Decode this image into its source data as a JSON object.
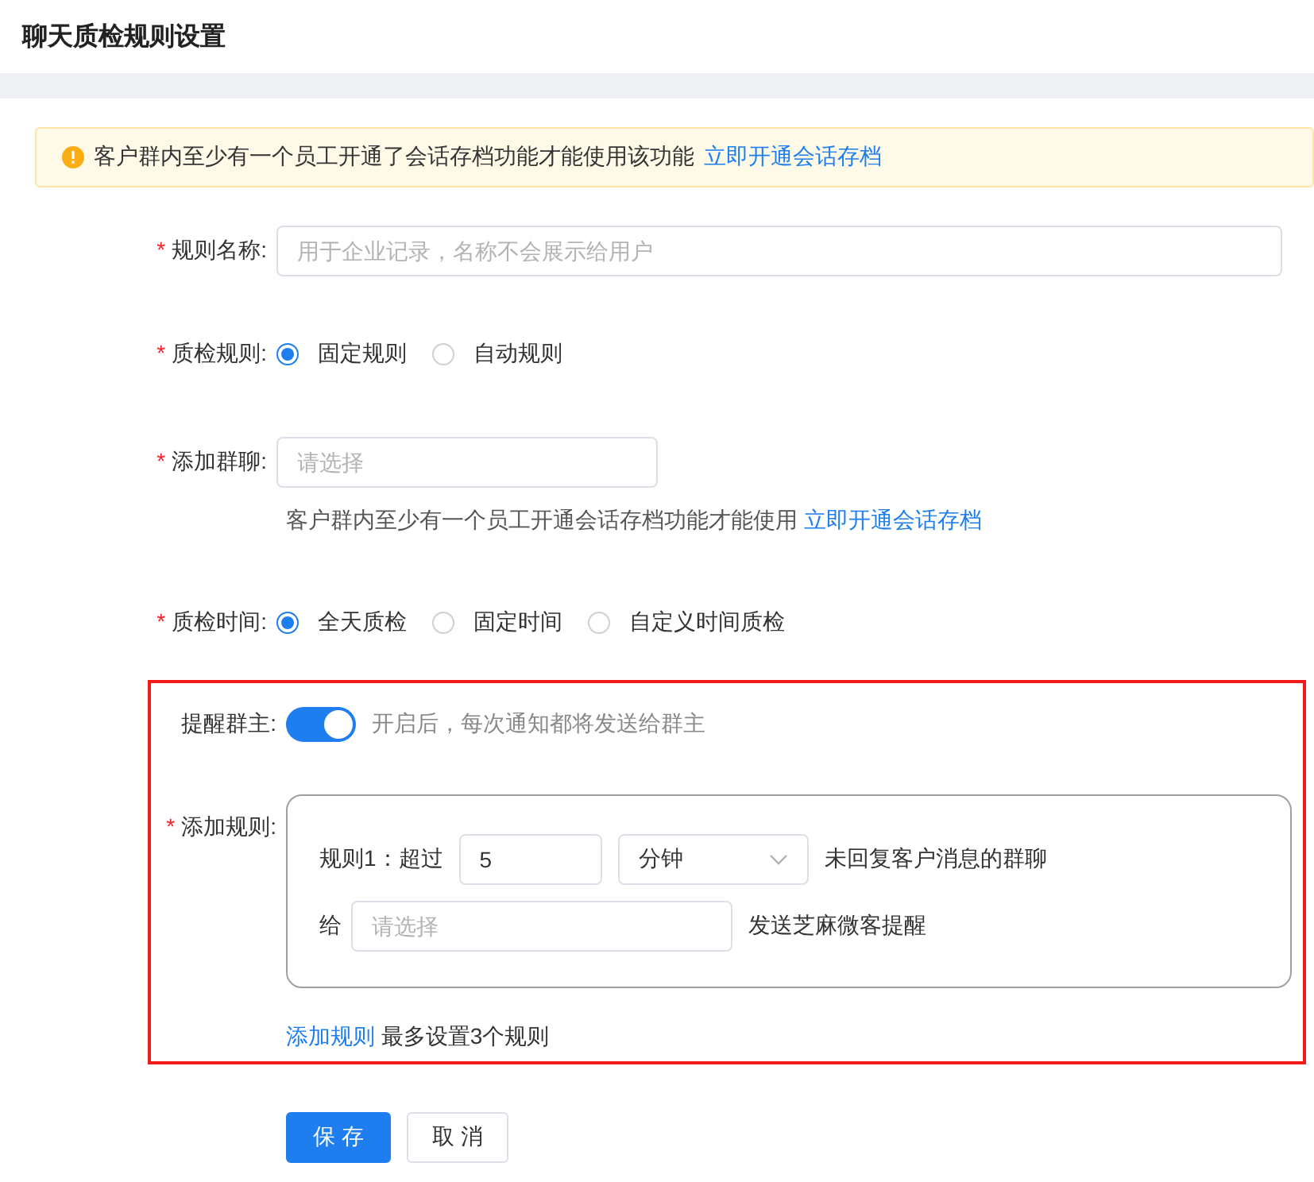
{
  "page_title": "聊天质检规则设置",
  "alert": {
    "text": "客户群内至少有一个员工开通了会话存档功能才能使用该功能",
    "link": "立即开通会话存档"
  },
  "rule_name": {
    "label": "规则名称:",
    "required_mark": "*",
    "placeholder": "用于企业记录，名称不会展示给用户"
  },
  "rule_type": {
    "label": "质检规则:",
    "required_mark": "*",
    "options": [
      {
        "label": "固定规则",
        "selected": true
      },
      {
        "label": "自动规则",
        "selected": false
      }
    ]
  },
  "group_chat": {
    "label": "添加群聊:",
    "required_mark": "*",
    "placeholder": "请选择",
    "hint": "客户群内至少有一个员工开通会话存档功能才能使用",
    "hint_link": "立即开通会话存档"
  },
  "check_time": {
    "label": "质检时间:",
    "required_mark": "*",
    "options": [
      {
        "label": "全天质检",
        "selected": true
      },
      {
        "label": "固定时间",
        "selected": false
      },
      {
        "label": "自定义时间质检",
        "selected": false
      }
    ]
  },
  "remind_owner": {
    "label": "提醒群主:",
    "on": true,
    "hint": "开启后，每次通知都将发送给群主"
  },
  "rules": {
    "label": "添加规则:",
    "required_mark": "*",
    "items": [
      {
        "prefix": "规则1：超过",
        "value": "5",
        "unit": "分钟",
        "suffix": "未回复客户消息的群聊",
        "to_label": "给",
        "to_placeholder": "请选择",
        "to_suffix": "发送芝麻微客提醒"
      }
    ],
    "add_link": "添加规则",
    "add_hint": "最多设置3个规则"
  },
  "buttons": [
    {
      "label": "保 存",
      "kind": "primary"
    },
    {
      "label": "取 消",
      "kind": "default"
    }
  ]
}
